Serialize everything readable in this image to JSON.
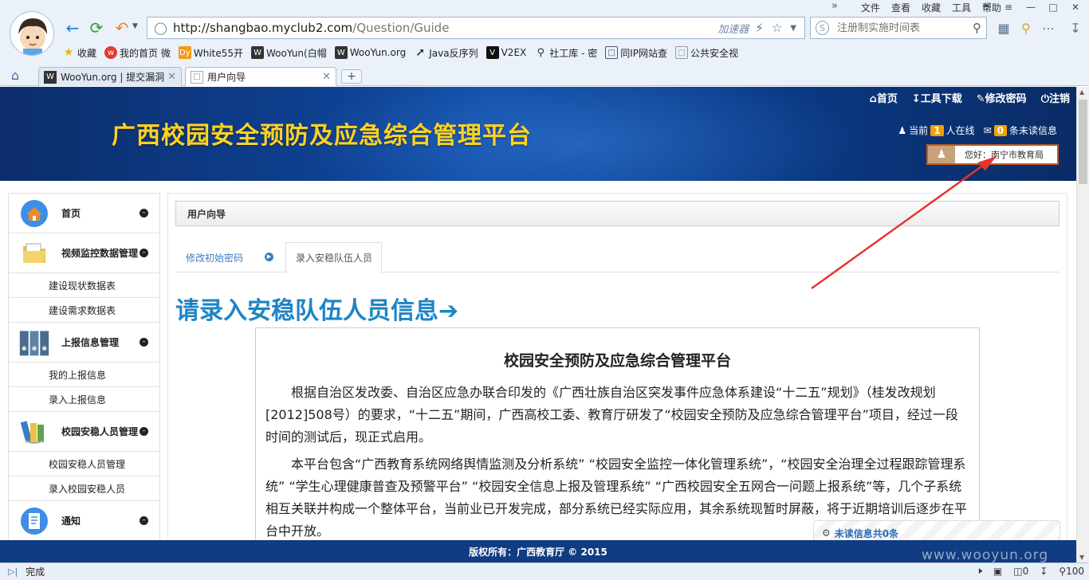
{
  "browser": {
    "url_host": "http://shangbao.myclub2.com",
    "url_path": "/Question/Guide",
    "accelerator": "加速器",
    "search_placeholder": "注册制实施时间表",
    "menu": [
      "文件",
      "查看",
      "收藏",
      "工具",
      "帮助"
    ],
    "bookmarks": [
      {
        "label": "收藏",
        "icon": "star-icon"
      },
      {
        "label": "我的首页 微",
        "icon": "weibo-icon"
      },
      {
        "label": "White55开",
        "icon": "dy-icon"
      },
      {
        "label": "WooYun(白帽",
        "icon": "wooyun-icon"
      },
      {
        "label": "WooYun.org",
        "icon": "wooyun-icon"
      },
      {
        "label": "Java反序列",
        "icon": "lightning-icon"
      },
      {
        "label": "V2EX",
        "icon": "v2ex-icon"
      },
      {
        "label": "社工库 - 密",
        "icon": "key-icon"
      },
      {
        "label": "同IP网站查",
        "icon": "page-icon"
      },
      {
        "label": "公共安全视",
        "icon": "page-icon"
      }
    ],
    "tabs": [
      {
        "label": "WooYun.org | 提交漏洞",
        "active": false
      },
      {
        "label": "用户向导",
        "active": true
      }
    ],
    "status": "完成",
    "status_right": {
      "count": "0",
      "zoom": "100"
    }
  },
  "site": {
    "title": "广西校园安全预防及应急综合管理平台",
    "topnav": [
      "首页",
      "工具下载",
      "修改密码",
      "注销"
    ],
    "online_prefix": "当前",
    "online_count": "1",
    "online_suffix": "人在线",
    "unread_count": "0",
    "unread_suffix": "条未读信息",
    "welcome": "您好：南宁市教育局"
  },
  "sidebar": [
    {
      "label": "首页",
      "icon": "home-globe-icon",
      "subs": []
    },
    {
      "label": "视频监控数据管理",
      "icon": "folder-icon",
      "subs": [
        "建设现状数据表",
        "建设需求数据表"
      ]
    },
    {
      "label": "上报信息管理",
      "icon": "binders-icon",
      "subs": [
        "我的上报信息",
        "录入上报信息"
      ]
    },
    {
      "label": "校园安稳人员管理",
      "icon": "books-icon",
      "subs": [
        "校园安稳人员管理",
        "录入校园安稳人员"
      ]
    },
    {
      "label": "通知",
      "icon": "notepad-icon",
      "subs": []
    }
  ],
  "main": {
    "breadcrumb": "用户向导",
    "steps": [
      "修改初始密码",
      "录入安稳队伍人员"
    ],
    "big_title": "请录入安稳队伍人员信息➔",
    "doc_title": "校园安全预防及应急综合管理平台",
    "paragraphs": [
      "根据自治区发改委、自治区应急办联合印发的《广西壮族自治区突发事件应急体系建设“十二五”规划》（桂发改规划[2012]508号）的要求，“十二五”期间，广西高校工委、教育厅研发了“校园安全预防及应急综合管理平台”项目，经过一段时间的测试后，现正式启用。",
      "本平台包含“广西教育系统网络舆情监测及分析系统” “校园安全监控一体化管理系统”，“校园安全治理全过程跟踪管理系统” “学生心理健康普查及预警平台” “校园安全信息上报及管理系统” “广西校园安全五网合一问题上报系统”等，几个子系统相互关联并构成一个整体平台，当前业已开发完成，部分系统已经实际应用，其余系统现暂时屏蔽，将于近期培训后逐步在平台中开放。"
    ],
    "unread_popup": "未读信息共0条"
  },
  "footer": "版权所有：广西教育厅 © 2015",
  "watermark": "www.wooyun.org",
  "colors": {
    "banner": "#0f4aa3",
    "title_yellow": "#ffd21f",
    "link_blue": "#1e84c6",
    "annotation_red": "#e8342b"
  }
}
